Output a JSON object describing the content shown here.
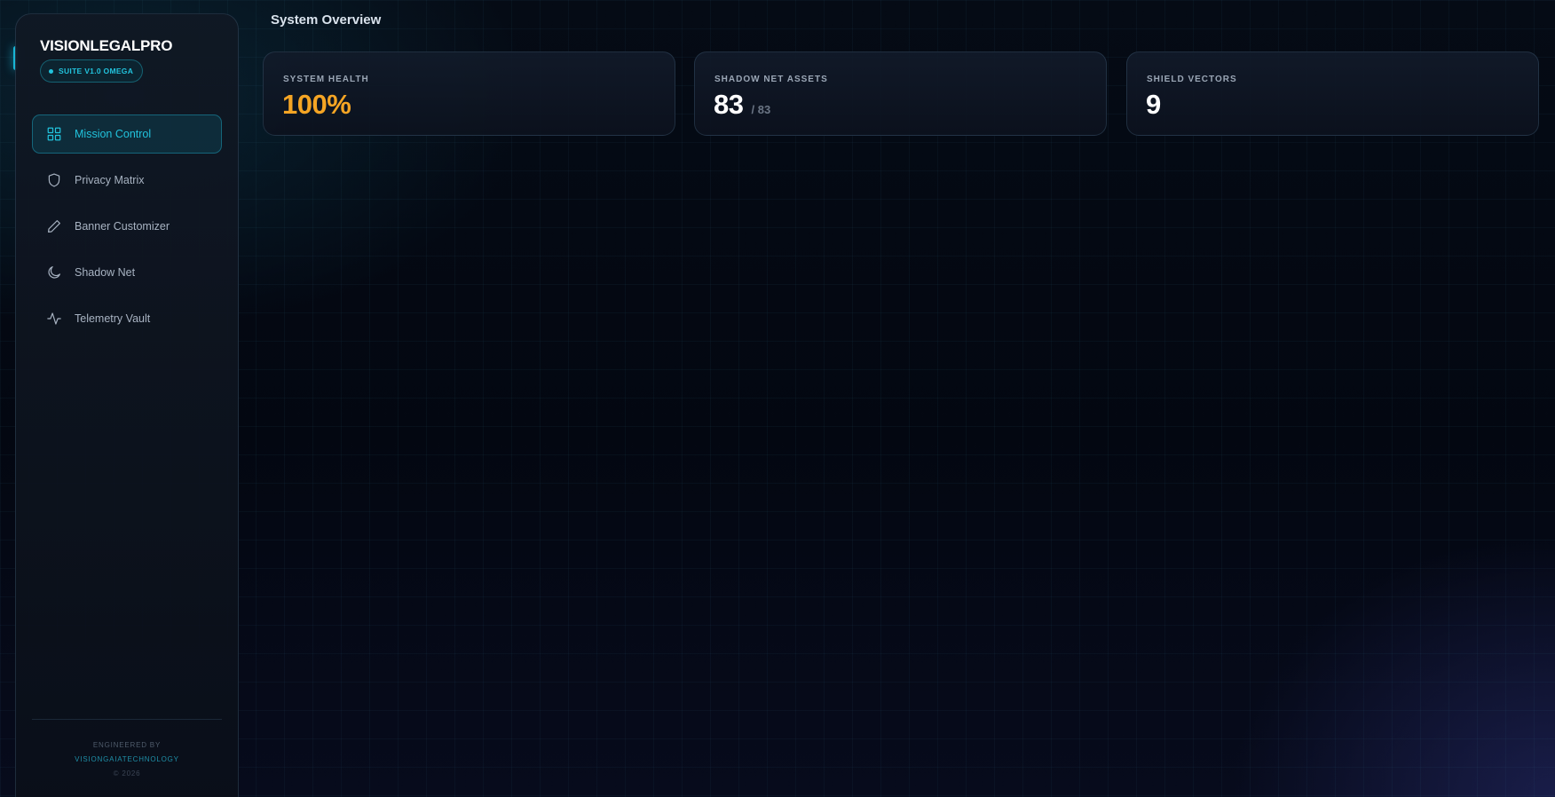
{
  "sidebar": {
    "brand": "VISIONLEGALPRO",
    "badge": "SUITE V1.0 OMEGA",
    "items": [
      {
        "label": "Mission Control",
        "icon": "grid-icon",
        "active": true
      },
      {
        "label": "Privacy Matrix",
        "icon": "shield-icon",
        "active": false
      },
      {
        "label": "Banner Customizer",
        "icon": "pen-icon",
        "active": false
      },
      {
        "label": "Shadow Net",
        "icon": "moon-icon",
        "active": false
      },
      {
        "label": "Telemetry Vault",
        "icon": "activity-icon",
        "active": false
      }
    ],
    "footer": {
      "engineered_by": "ENGINEERED BY",
      "company": "VISIONGAIATECHNOLOGY",
      "copyright": "© 2026"
    }
  },
  "header": {
    "title": "System Overview"
  },
  "stats": [
    {
      "label": "SYSTEM HEALTH",
      "value": "100%",
      "suffix": ""
    },
    {
      "label": "SHADOW NET ASSETS",
      "value": "83",
      "suffix": "/ 83"
    },
    {
      "label": "SHIELD VECTORS",
      "value": "9",
      "suffix": ""
    }
  ],
  "colors": {
    "accent": "#22c3dd",
    "health": "#f5a524",
    "background": "#030711"
  }
}
